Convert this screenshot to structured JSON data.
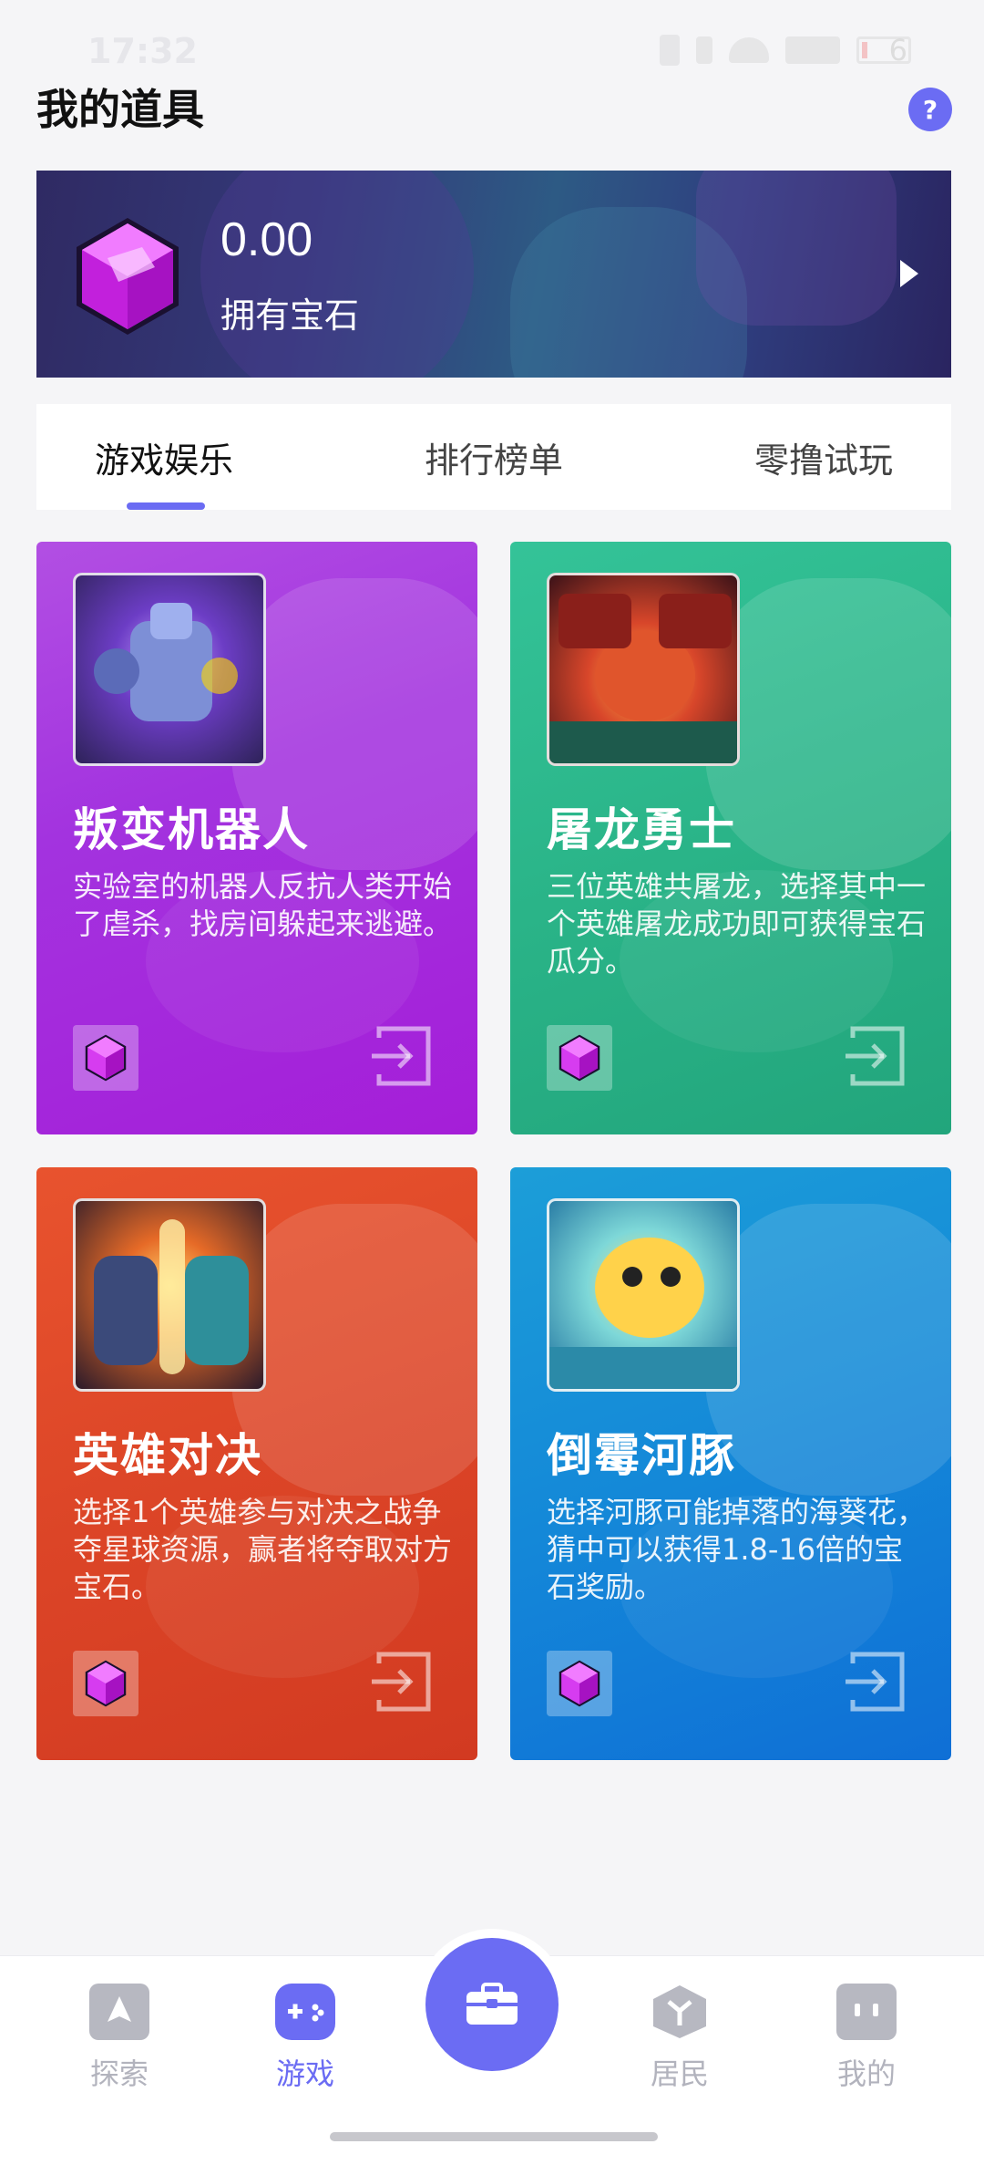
{
  "status_bar": {
    "time": "17:32",
    "battery": "6"
  },
  "header": {
    "title": "我的道具",
    "help_icon": "question-icon",
    "help_label": "?"
  },
  "gem_banner": {
    "amount": "0.00",
    "label": "拥有宝石",
    "icon": "gem-icon"
  },
  "tabs": [
    {
      "label": "游戏娱乐",
      "active": true
    },
    {
      "label": "排行榜单",
      "active": false
    },
    {
      "label": "零撸试玩",
      "active": false
    }
  ],
  "games": [
    {
      "title": "叛变机器人",
      "desc": "实验室的机器人反抗人类开始了虐杀，找房间躲起来逃避。",
      "color": "#a333df"
    },
    {
      "title": "屠龙勇士",
      "desc": "三位英雄共屠龙，选择其中一个英雄屠龙成功即可获得宝石瓜分。",
      "color": "#2ab488"
    },
    {
      "title": "英雄对决",
      "desc": "选择1个英雄参与对决之战争夺星球资源，赢者将夺取对方宝石。",
      "color": "#dc4527"
    },
    {
      "title": "倒霉河豚",
      "desc": "选择河豚可能掉落的海葵花，猜中可以获得1.8-16倍的宝石奖励。",
      "color": "#1488d8"
    }
  ],
  "bottom_nav": [
    {
      "label": "探索",
      "icon": "explore-icon",
      "active": false
    },
    {
      "label": "游戏",
      "icon": "gamepad-icon",
      "active": true
    },
    {
      "label": "",
      "icon": "briefcase-icon",
      "active": false
    },
    {
      "label": "居民",
      "icon": "resident-icon",
      "active": false
    },
    {
      "label": "我的",
      "icon": "profile-icon",
      "active": false
    }
  ],
  "colors": {
    "accent": "#6b6cf3",
    "gem": "#d63cf0"
  }
}
